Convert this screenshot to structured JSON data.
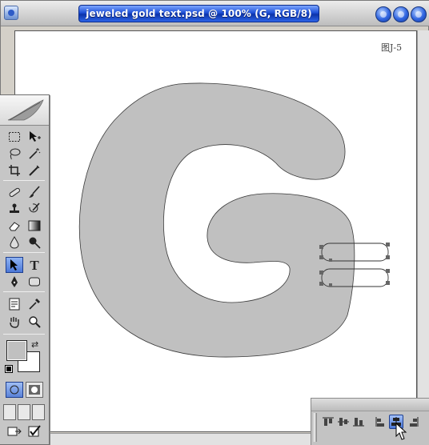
{
  "window": {
    "title": "jeweled gold text.psd @ 100% (G, RGB/8)",
    "buttons": [
      "minimize",
      "maximize",
      "close"
    ]
  },
  "canvas": {
    "figure_label": "图J-5",
    "background": "#ffffff",
    "letter_fill": "#c0c0c0"
  },
  "toolbox": {
    "tools": [
      "marquee-tool",
      "move-tool",
      "lasso-tool",
      "magic-wand-tool",
      "crop-tool",
      "slice-tool",
      "healing-brush-tool",
      "brush-tool",
      "clone-stamp-tool",
      "history-brush-tool",
      "eraser-tool",
      "gradient-tool",
      "blur-tool",
      "dodge-tool",
      "path-selection-tool",
      "type-tool",
      "pen-tool",
      "shape-tool",
      "notes-tool",
      "eyedropper-tool",
      "hand-tool",
      "zoom-tool"
    ],
    "selected_tool": "path-selection-tool",
    "type_tool_glyph": "T",
    "foreground_color": "#c0c0c0",
    "background_color": "#ffffff"
  },
  "align_palette": {
    "buttons": [
      "align-top",
      "align-vertical-center",
      "align-bottom",
      "align-left",
      "align-horizontal-center",
      "align-right"
    ],
    "selected": "align-horizontal-center"
  }
}
